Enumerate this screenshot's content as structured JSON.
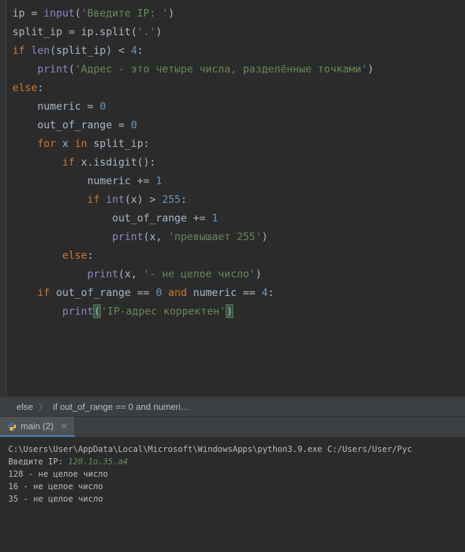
{
  "code": {
    "lines": [
      {
        "tokens": [
          [
            "ident",
            "ip "
          ],
          [
            "op",
            "= "
          ],
          [
            "builtin",
            "input"
          ],
          [
            "op",
            "("
          ],
          [
            "str",
            "'Введите IP: '"
          ],
          [
            "op",
            ")"
          ]
        ]
      },
      {
        "tokens": [
          [
            "ident",
            "split_ip "
          ],
          [
            "op",
            "= "
          ],
          [
            "ident",
            "ip.split"
          ],
          [
            "op",
            "("
          ],
          [
            "str",
            "'.'"
          ],
          [
            "op",
            ")"
          ]
        ]
      },
      {
        "tokens": [
          [
            "kw",
            "if "
          ],
          [
            "builtin",
            "len"
          ],
          [
            "op",
            "("
          ],
          [
            "ident",
            "split_ip"
          ],
          [
            "op",
            ") < "
          ],
          [
            "num",
            "4"
          ],
          [
            "op",
            ":"
          ]
        ]
      },
      {
        "indent": 1,
        "tokens": [
          [
            "builtin",
            "print"
          ],
          [
            "op",
            "("
          ],
          [
            "str",
            "'Адрес - это четыре числа, разделённые точками'"
          ],
          [
            "op",
            ")"
          ]
        ]
      },
      {
        "tokens": [
          [
            "kw",
            "else"
          ],
          [
            "op",
            ":"
          ]
        ]
      },
      {
        "indent": 1,
        "tokens": [
          [
            "ident",
            "numeric "
          ],
          [
            "op",
            "= "
          ],
          [
            "num",
            "0"
          ]
        ]
      },
      {
        "indent": 1,
        "tokens": [
          [
            "ident",
            "out_of_range "
          ],
          [
            "op",
            "= "
          ],
          [
            "num",
            "0"
          ]
        ]
      },
      {
        "indent": 1,
        "tokens": [
          [
            "kw",
            "for "
          ],
          [
            "ident",
            "x "
          ],
          [
            "kw",
            "in "
          ],
          [
            "ident",
            "split_ip"
          ],
          [
            "op",
            ":"
          ]
        ]
      },
      {
        "indent": 2,
        "tokens": [
          [
            "kw",
            "if "
          ],
          [
            "ident",
            "x.isdigit"
          ],
          [
            "op",
            "():"
          ]
        ]
      },
      {
        "indent": 3,
        "tokens": [
          [
            "ident",
            "numeric "
          ],
          [
            "op",
            "+= "
          ],
          [
            "num",
            "1"
          ]
        ]
      },
      {
        "indent": 3,
        "tokens": [
          [
            "kw",
            "if "
          ],
          [
            "builtin",
            "int"
          ],
          [
            "op",
            "("
          ],
          [
            "ident",
            "x"
          ],
          [
            "op",
            ") > "
          ],
          [
            "num",
            "255"
          ],
          [
            "op",
            ":"
          ]
        ]
      },
      {
        "indent": 4,
        "tokens": [
          [
            "ident",
            "out_of_range "
          ],
          [
            "op",
            "+= "
          ],
          [
            "num",
            "1"
          ]
        ]
      },
      {
        "indent": 4,
        "tokens": [
          [
            "builtin",
            "print"
          ],
          [
            "op",
            "("
          ],
          [
            "ident",
            "x"
          ],
          [
            "op",
            ", "
          ],
          [
            "str",
            "'превышает 255'"
          ],
          [
            "op",
            ")"
          ]
        ]
      },
      {
        "indent": 2,
        "tokens": [
          [
            "kw",
            "else"
          ],
          [
            "op",
            ":"
          ]
        ]
      },
      {
        "indent": 3,
        "tokens": [
          [
            "builtin",
            "print"
          ],
          [
            "op",
            "("
          ],
          [
            "ident",
            "x"
          ],
          [
            "op",
            ", "
          ],
          [
            "str",
            "'- не целое число'"
          ],
          [
            "op",
            ")"
          ]
        ]
      },
      {
        "indent": 1,
        "tokens": [
          [
            "kw",
            "if "
          ],
          [
            "ident",
            "out_of_range "
          ],
          [
            "op",
            "== "
          ],
          [
            "num",
            "0"
          ],
          [
            "kw",
            " and "
          ],
          [
            "ident",
            "numeric "
          ],
          [
            "op",
            "== "
          ],
          [
            "num",
            "4"
          ],
          [
            "op",
            ":"
          ]
        ]
      },
      {
        "indent": 2,
        "tokens": [
          [
            "builtin",
            "print"
          ],
          [
            "op",
            "("
          ],
          [
            "str",
            "'IP-адрес корректен'"
          ],
          [
            "op",
            ")"
          ]
        ],
        "cursorAfter": true
      }
    ]
  },
  "breadcrumb": {
    "crumbs": [
      "else",
      "if out_of_range == 0 and numeri…"
    ]
  },
  "tabs": {
    "active": {
      "label": "main (2)",
      "icon": "python-icon"
    }
  },
  "console": {
    "path": "C:\\Users\\User\\AppData\\Local\\Microsoft\\WindowsApps\\python3.9.exe C:/Users/User/Pyc",
    "prompt": "Введите IP: ",
    "input": "128.1o.35.a4",
    "output": [
      "128 - не целое число",
      "16 - не целое число",
      "35 - не целое число"
    ]
  }
}
